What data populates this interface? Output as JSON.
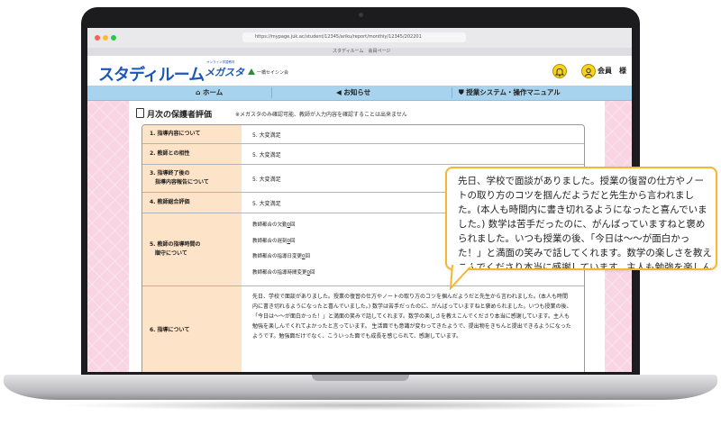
{
  "browser": {
    "url": "https://mypage.juk.ac/student/12345/ariku/report/monthly/12345/202201",
    "tab_title": "スタディルーム　会員ページ"
  },
  "header": {
    "logo": "スタディルーム",
    "brand_tag": "オンライン学習教材",
    "brand": "メガスタ",
    "brand2": "一橋セイシン会",
    "user_label": "会員　様"
  },
  "nav": [
    {
      "label": "ホーム",
      "icon": "home-icon"
    },
    {
      "label": "お知らせ",
      "icon": "megaphone-icon"
    },
    {
      "label": "授業システム・操作マニュアル",
      "icon": "shield-icon"
    }
  ],
  "panel": {
    "title": "月次の保護者評価",
    "note": "※メガスタのみ確認可能、教師が入力内容を確認することは出来ません"
  },
  "rows": [
    {
      "label": "1. 指導内容について",
      "value": "5. 大変満足"
    },
    {
      "label": "2. 教師との相性",
      "value": "5. 大変満足"
    },
    {
      "label": "3. 指導終了後の\n　指導内容報告について",
      "value": "5. 大変満足"
    },
    {
      "label": "4. 教師総合評価",
      "value": "5. 大変満足"
    },
    {
      "label": "5. 教師の指導時間の\n　順守について",
      "value": ""
    },
    {
      "label": "6. 指導について",
      "value": ""
    }
  ],
  "schedule_items": [
    "教師都合の欠勤",
    "教師都合の遅刻",
    "教師都合の指導日変更",
    "教師都合の指導時間変更"
  ],
  "schedule_counts": [
    "0",
    "0",
    "0",
    "0"
  ],
  "schedule_unit": "回",
  "comment": "先日、学校で面談がありました。授業の復習の仕方やノートの取り方のコツを掴んだようだと先生から言われました。(本人も時間内に書き切れるようになったと喜んでいました。) 数学は苦手だったのに、がんばっていますねと褒められました。いつも授業の後、「今日は〜〜が面白かった！」と満面の笑みで話してくれます。数学の楽しさを教えこんでくださり本当に感謝しています。主人も勉強を楽しんでくれてよかったと言っています。 生活面でも意識が変わってきたようで、提出物をきちんと提出できるようになったようです。勉強面だけでなく、こういった面でも成長を感じられて、感謝しています。",
  "callout": "先日、学校で面談がありました。授業の復習の仕方やノートの取り方のコツを掴んだようだと先生から言われました。(本人も時間内に書き切れるようになったと喜んでいました。) 数学は苦手だったのに、がんばっていますねと褒められました。いつも授業の後、「今日は〜〜が面白かった！」と満面の笑みで話してくれます。数学の楽しさを教えこんでくださり本当に感謝しています。主人も勉強を楽しんでくれてよかったと言っています。 生活面でも意識が変わってきたようで、提出物をきちんと提出できるようになったようです。勉強面だけでなく、こういった面でも成長を感じられて、感謝しています。",
  "colors": {
    "brand_blue": "#1b57b8",
    "nav_bg": "#a8d3ee",
    "label_bg": "#fde3c8",
    "page_bg": "#f9d5e3",
    "callout_border": "#f5b731"
  }
}
